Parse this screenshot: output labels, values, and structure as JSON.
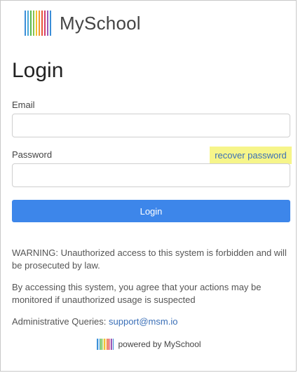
{
  "brand": {
    "name": "MySchool",
    "logo_colors": [
      "#3b8ed8",
      "#4aa9d9",
      "#59b94f",
      "#8bc34a",
      "#f2c12e",
      "#f29a2e",
      "#e8553a",
      "#d63b6e",
      "#9b59b6",
      "#3b8ed8"
    ]
  },
  "page": {
    "title": "Login"
  },
  "form": {
    "email_label": "Email",
    "email_value": "",
    "password_label": "Password",
    "password_value": "",
    "recover_link": "recover password",
    "submit_label": "Login"
  },
  "notices": {
    "warning": "WARNING: Unauthorized access to this system is forbidden and will be prosecuted by law.",
    "consent": "By accessing this system, you agree that your actions may be monitored if unauthorized usage is suspected",
    "admin_prefix": "Administrative Queries: ",
    "admin_email": "support@msm.io"
  },
  "footer": {
    "powered_by": "powered by MySchool"
  },
  "colors": {
    "primary_button": "#3d86ea",
    "link": "#3a6fb7",
    "highlight": "#f6f58a"
  }
}
